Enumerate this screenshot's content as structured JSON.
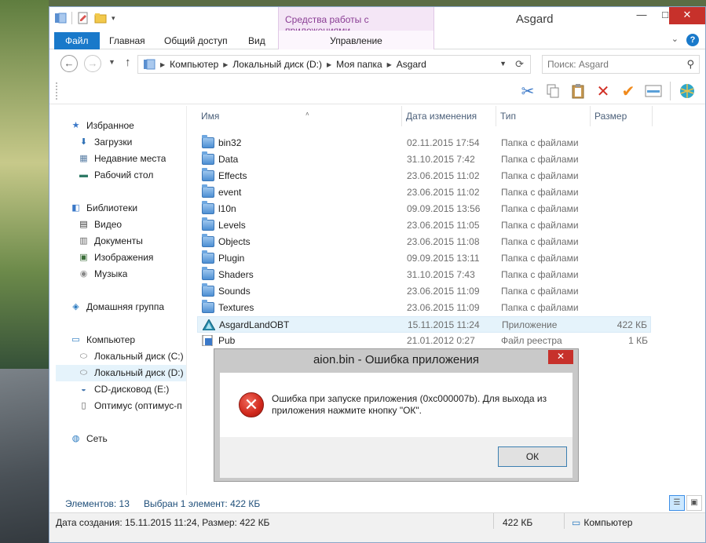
{
  "window": {
    "title": "Asgard",
    "context_tab_group": "Средства работы с приложениями",
    "minimize": "—",
    "maximize": "□",
    "close": "✕"
  },
  "ribbon": {
    "tabs": [
      "Файл",
      "Главная",
      "Общий доступ",
      "Вид"
    ],
    "context_tab": "Управление"
  },
  "address": {
    "breadcrumbs": [
      "Компьютер",
      "Локальный диск (D:)",
      "Моя папка",
      "Asgard"
    ]
  },
  "search": {
    "placeholder": "Поиск: Asgard"
  },
  "nav": {
    "favorites": "Избранное",
    "downloads": "Загрузки",
    "recent": "Недавние места",
    "desktop": "Рабочий стол",
    "libraries": "Библиотеки",
    "video": "Видео",
    "documents": "Документы",
    "pictures": "Изображения",
    "music": "Музыка",
    "homegroup": "Домашняя группа",
    "computer": "Компьютер",
    "disk_c": "Локальный диск (C:)",
    "disk_d": "Локальный диск (D:)",
    "cd": "CD-дисковод (E:)",
    "optimus": "Оптимус (оптимус-п",
    "network": "Сеть"
  },
  "columns": {
    "name": "Имя",
    "date": "Дата изменения",
    "type": "Тип",
    "size": "Размер"
  },
  "files": [
    {
      "name": "bin32",
      "date": "02.11.2015 17:54",
      "type": "Папка с файлами",
      "size": ""
    },
    {
      "name": "Data",
      "date": "31.10.2015 7:42",
      "type": "Папка с файлами",
      "size": ""
    },
    {
      "name": "Effects",
      "date": "23.06.2015 11:02",
      "type": "Папка с файлами",
      "size": ""
    },
    {
      "name": "event",
      "date": "23.06.2015 11:02",
      "type": "Папка с файлами",
      "size": ""
    },
    {
      "name": "l10n",
      "date": "09.09.2015 13:56",
      "type": "Папка с файлами",
      "size": ""
    },
    {
      "name": "Levels",
      "date": "23.06.2015 11:05",
      "type": "Папка с файлами",
      "size": ""
    },
    {
      "name": "Objects",
      "date": "23.06.2015 11:08",
      "type": "Папка с файлами",
      "size": ""
    },
    {
      "name": "Plugin",
      "date": "09.09.2015 13:11",
      "type": "Папка с файлами",
      "size": ""
    },
    {
      "name": "Shaders",
      "date": "31.10.2015 7:43",
      "type": "Папка с файлами",
      "size": ""
    },
    {
      "name": "Sounds",
      "date": "23.06.2015 11:09",
      "type": "Папка с файлами",
      "size": ""
    },
    {
      "name": "Textures",
      "date": "23.06.2015 11:09",
      "type": "Папка с файлами",
      "size": ""
    },
    {
      "name": "AsgardLandOBT",
      "date": "15.11.2015 11:24",
      "type": "Приложение",
      "size": "422 КБ"
    },
    {
      "name": "Pub",
      "date": "21.01.2012 0:27",
      "type": "Файл реестра",
      "size": "1 КБ"
    }
  ],
  "status": {
    "items": "Элементов: 13",
    "selected": "Выбран 1 элемент: 422 КБ",
    "details": "Дата создания: 15.11.2015 11:24, Размер: 422 КБ",
    "size": "422 КБ",
    "location": "Компьютер"
  },
  "dialog": {
    "title": "aion.bin - Ошибка приложения",
    "message": "Ошибка при запуске приложения (0xc000007b). Для выхода из приложения нажмите кнопку \"ОК\".",
    "ok": "ОК",
    "close": "✕"
  },
  "colors": {
    "accent": "#1979ca",
    "selection": "#e5f3fb",
    "error": "#d0281c",
    "context": "#8a3d94"
  }
}
